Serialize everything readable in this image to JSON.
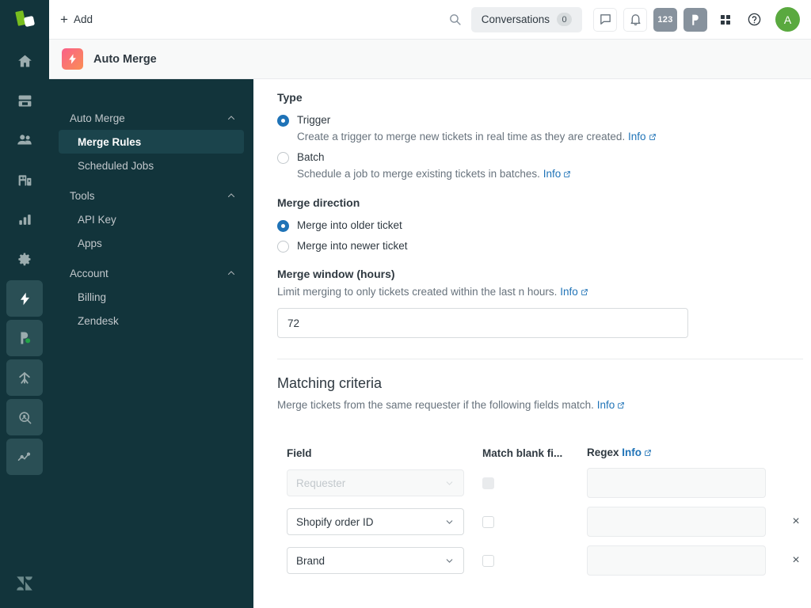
{
  "topbar": {
    "add_label": "Add",
    "search_icon": "search-icon",
    "conversations_label": "Conversations",
    "conversations_count": "0",
    "chat_icon": "chat-bubble-icon",
    "bell_icon": "bell-icon",
    "numbers_label": "123",
    "p_label": "P",
    "grid_icon": "apps-grid-icon",
    "help_icon": "help-circle-icon",
    "avatar_initial": "A"
  },
  "appbar": {
    "title": "Auto Merge",
    "icon": "lightning-bolt-icon"
  },
  "rail": {
    "logo": "product-logo",
    "items": [
      {
        "name": "home-icon",
        "style": "plain"
      },
      {
        "name": "views-icon",
        "style": "plain"
      },
      {
        "name": "customers-icon",
        "style": "plain"
      },
      {
        "name": "organizations-icon",
        "style": "plain"
      },
      {
        "name": "reporting-icon",
        "style": "plain"
      },
      {
        "name": "admin-gear-icon",
        "style": "plain"
      },
      {
        "name": "auto-merge-bolt-icon",
        "style": "boxed"
      },
      {
        "name": "proactive-p-icon",
        "style": "boxed"
      },
      {
        "name": "merge-arrow-icon",
        "style": "boxed"
      },
      {
        "name": "search-user-icon",
        "style": "boxed"
      },
      {
        "name": "analytics-line-icon",
        "style": "boxed"
      }
    ],
    "bottom_icon": "zendesk-logo-icon"
  },
  "nav": {
    "groups": [
      {
        "label": "Auto Merge",
        "items": [
          {
            "label": "Merge Rules",
            "active": true
          },
          {
            "label": "Scheduled Jobs",
            "active": false
          }
        ]
      },
      {
        "label": "Tools",
        "items": [
          {
            "label": "API Key",
            "active": false
          },
          {
            "label": "Apps",
            "active": false
          }
        ]
      },
      {
        "label": "Account",
        "items": [
          {
            "label": "Billing",
            "active": false
          },
          {
            "label": "Zendesk",
            "active": false
          }
        ]
      }
    ]
  },
  "main": {
    "type": {
      "heading": "Type",
      "options": [
        {
          "label": "Trigger",
          "selected": true,
          "description": "Create a trigger to merge new tickets in real time as they are created.",
          "info_label": "Info"
        },
        {
          "label": "Batch",
          "selected": false,
          "description": "Schedule a job to merge existing tickets in batches.",
          "info_label": "Info"
        }
      ]
    },
    "merge_direction": {
      "heading": "Merge direction",
      "options": [
        {
          "label": "Merge into older ticket",
          "selected": true
        },
        {
          "label": "Merge into newer ticket",
          "selected": false
        }
      ]
    },
    "merge_window": {
      "heading": "Merge window (hours)",
      "description": "Limit merging to only tickets created within the last n hours.",
      "info_label": "Info",
      "value": "72",
      "placeholder": ""
    },
    "matching_criteria": {
      "heading": "Matching criteria",
      "description": "Merge tickets from the same requester if the following fields match.",
      "info_label": "Info",
      "columns": {
        "field": "Field",
        "match_blank": "Match blank fi...",
        "regex": "Regex",
        "regex_info": "Info"
      },
      "rows": [
        {
          "field": "Requester",
          "disabled": true,
          "match_blank": false,
          "regex": "",
          "removable": false
        },
        {
          "field": "Shopify order ID",
          "disabled": false,
          "match_blank": false,
          "regex": "",
          "removable": true
        },
        {
          "field": "Brand",
          "disabled": false,
          "match_blank": false,
          "regex": "",
          "removable": true
        }
      ],
      "remove_label": "×"
    }
  },
  "colors": {
    "rail_bg": "#12343b",
    "nav_active_bg": "#1b444c",
    "accent_blue": "#1f73b7",
    "avatar_green": "#5aa93f",
    "app_icon_gradient_start": "#f9608a",
    "app_icon_gradient_end": "#fb8e54"
  }
}
